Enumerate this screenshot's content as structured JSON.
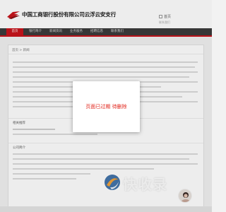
{
  "header": {
    "site_title": "中国工商银行股份有限公司云浮云安支行",
    "right_label": "首页",
    "right_sub": "联系我们"
  },
  "nav": {
    "items": [
      "首页",
      "银行简介",
      "新闻资讯",
      "业务服务",
      "招聘信息",
      "联系我们"
    ]
  },
  "content": {
    "breadcrumb": "首页 > 新闻",
    "section_1": "相关推荐",
    "section_2": "公司简介"
  },
  "modal": {
    "message": "页面已过期 待删除"
  },
  "watermark": {
    "text": "快收录"
  },
  "colors": {
    "accent": "#c9141b",
    "modal_text": "#e1251b",
    "nav_bg": "#3c3c3c"
  }
}
